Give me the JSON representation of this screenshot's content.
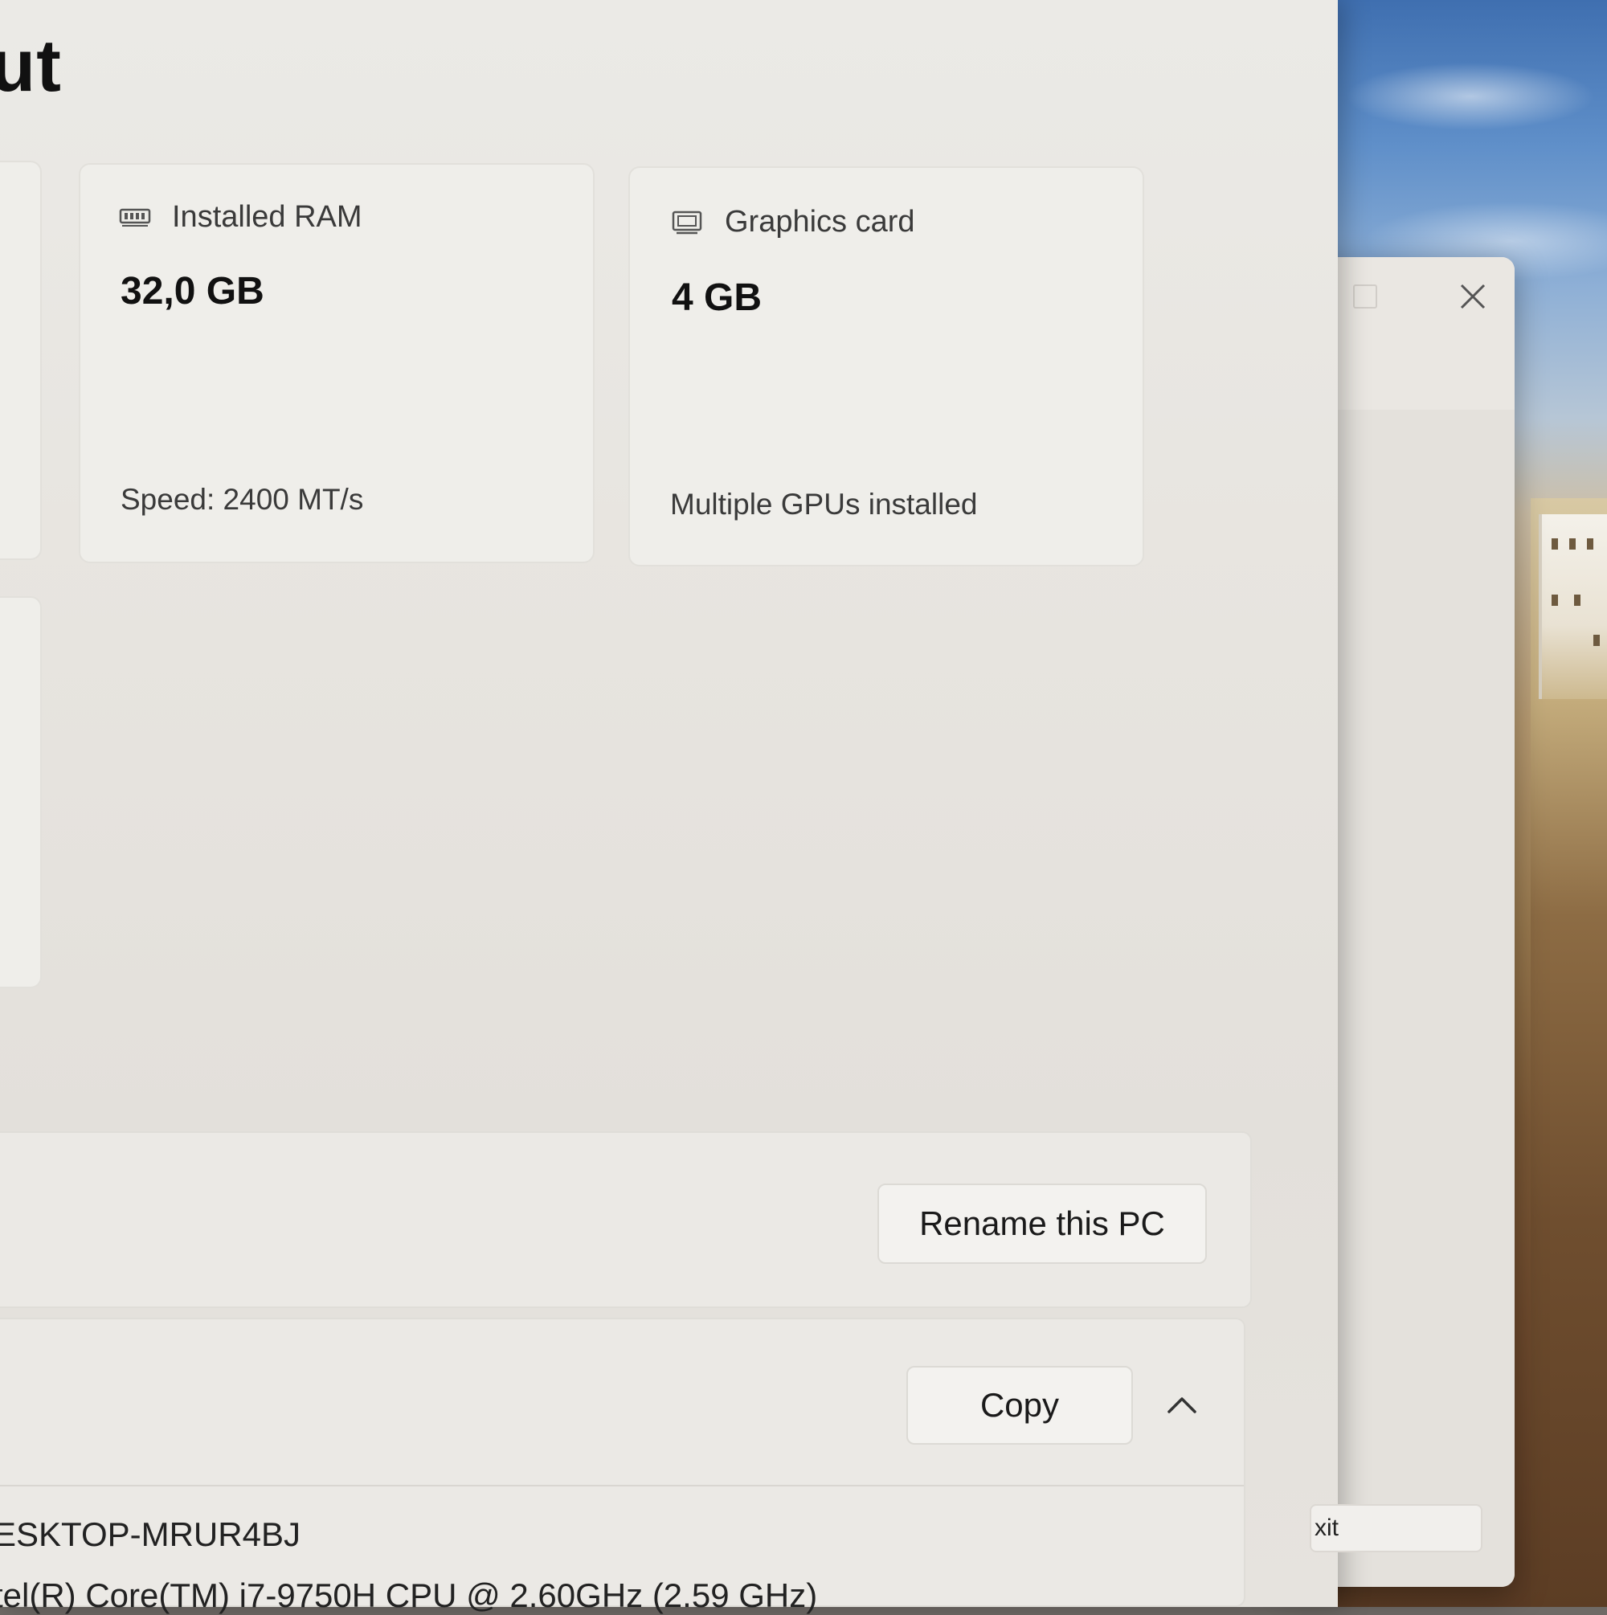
{
  "page": {
    "title": "ut"
  },
  "cards": {
    "ram": {
      "icon": "memory-icon",
      "label": "Installed RAM",
      "value": "32,0 GB",
      "sub": "Speed: 2400 MT/s"
    },
    "gpu": {
      "icon": "display-icon",
      "label": "Graphics card",
      "value": "4 GB",
      "sub": "Multiple GPUs installed"
    }
  },
  "actions": {
    "rename_label": "Rename this PC",
    "copy_label": "Copy",
    "collapse_icon": "chevron-up-icon"
  },
  "specs": {
    "device_name": "ESKTOP-MRUR4BJ",
    "processor": "tel(R) Core(TM) i7-9750H CPU @ 2.60GHz (2.59 GHz)"
  },
  "dialog": {
    "close_icon": "close-icon",
    "maximize_icon": "maximize-icon",
    "button_label": "xit"
  },
  "colors": {
    "window_bg": "#ebeae6",
    "card_bg": "#efeeea",
    "text": "#111111"
  }
}
